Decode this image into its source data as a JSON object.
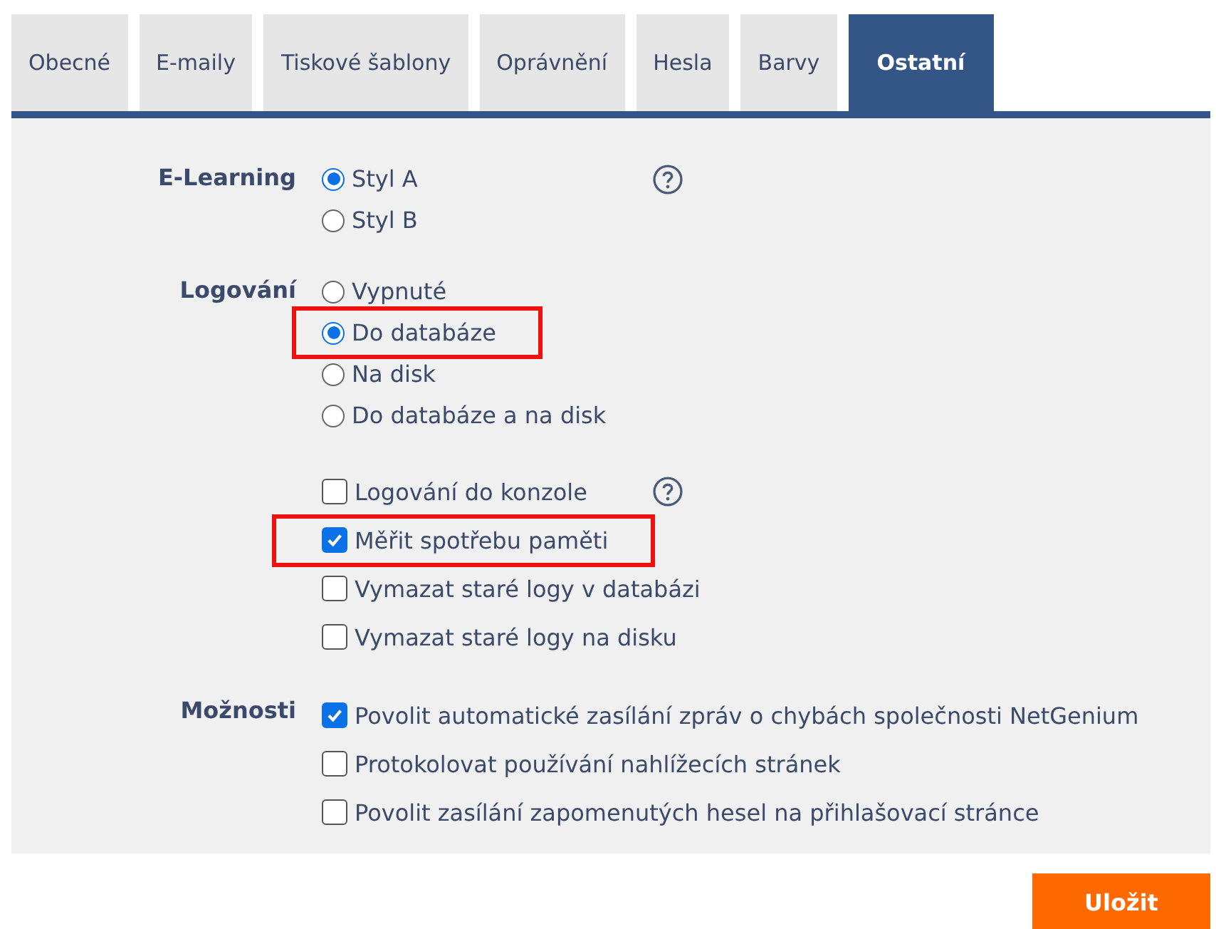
{
  "tabs": [
    {
      "label": "Obecné",
      "selected": false
    },
    {
      "label": "E-maily",
      "selected": false
    },
    {
      "label": "Tiskové šablony",
      "selected": false
    },
    {
      "label": "Oprávnění",
      "selected": false
    },
    {
      "label": "Hesla",
      "selected": false
    },
    {
      "label": "Barvy",
      "selected": false
    },
    {
      "label": "Ostatní",
      "selected": true
    }
  ],
  "sections": [
    {
      "label": "E-Learning",
      "groups": [
        [
          {
            "kind": "radio",
            "label": "Styl A",
            "selected": true,
            "highlighted": false,
            "help": true
          },
          {
            "kind": "radio",
            "label": "Styl B",
            "selected": false,
            "highlighted": false,
            "help": false
          }
        ]
      ]
    },
    {
      "label": "Logování",
      "groups": [
        [
          {
            "kind": "radio",
            "label": "Vypnuté",
            "selected": false,
            "highlighted": false,
            "help": false
          },
          {
            "kind": "radio",
            "label": "Do databáze",
            "selected": true,
            "highlighted": true,
            "help": false
          },
          {
            "kind": "radio",
            "label": "Na disk",
            "selected": false,
            "highlighted": false,
            "help": false
          },
          {
            "kind": "radio",
            "label": "Do databáze a na disk",
            "selected": false,
            "highlighted": false,
            "help": false
          }
        ],
        [
          {
            "kind": "checkbox",
            "label": "Logování do konzole",
            "checked": false,
            "highlighted": false,
            "help": true
          },
          {
            "kind": "checkbox",
            "label": "Měřit spotřebu paměti",
            "checked": true,
            "highlighted": true,
            "help": false
          },
          {
            "kind": "checkbox",
            "label": "Vymazat staré logy v databázi",
            "checked": false,
            "highlighted": false,
            "help": false
          },
          {
            "kind": "checkbox",
            "label": "Vymazat staré logy na disku",
            "checked": false,
            "highlighted": false,
            "help": false
          }
        ]
      ]
    },
    {
      "label": "Možnosti",
      "groups": [
        [
          {
            "kind": "checkbox",
            "label": "Povolit automatické zasílání zpráv o chybách společnosti NetGenium",
            "checked": true,
            "highlighted": false,
            "help": false
          },
          {
            "kind": "checkbox",
            "label": "Protokolovat používání nahlížecích stránek",
            "checked": false,
            "highlighted": false,
            "help": false
          },
          {
            "kind": "checkbox",
            "label": "Povolit zasílání zapomenutých hesel na přihlašovací stránce",
            "checked": false,
            "highlighted": false,
            "help": false
          }
        ]
      ]
    }
  ],
  "save_button": "Uložit"
}
